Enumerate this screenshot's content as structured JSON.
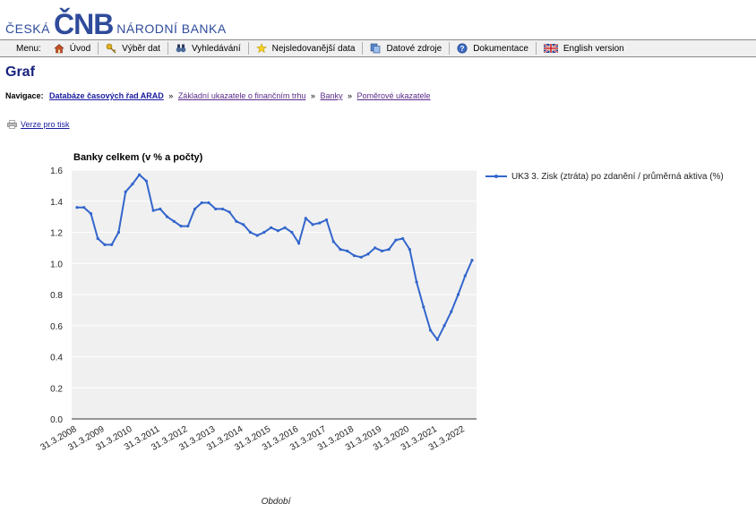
{
  "header": {
    "logo_left": "ČESKÁ",
    "logo_mid": "ČNB",
    "logo_right": "NÁRODNÍ BANKA"
  },
  "menu": {
    "label": "Menu:",
    "items": [
      {
        "label": "Úvod",
        "icon": "home-icon"
      },
      {
        "label": "Výběr dat",
        "icon": "key-icon"
      },
      {
        "label": "Vyhledávání",
        "icon": "binoculars-icon"
      },
      {
        "label": "Nejsledovanější data",
        "icon": "star-icon"
      },
      {
        "label": "Datové zdroje",
        "icon": "database-icon"
      },
      {
        "label": "Dokumentace",
        "icon": "help-icon"
      },
      {
        "label": "English version",
        "icon": "uk-flag-icon"
      }
    ]
  },
  "page": {
    "title": "Graf",
    "nav_label": "Navigace:",
    "breadcrumb": [
      "Databáze časových řad ARAD",
      "Základní ukazatele o finančním trhu",
      "Banky",
      "Poměrové ukazatele"
    ],
    "breadcrumb_sep": "»",
    "print_link": "Verze pro tisk"
  },
  "chart_data": {
    "type": "line",
    "title": "Banky celkem (v % a počty)",
    "xlabel": "Období",
    "ylabel": "",
    "ylim": [
      0,
      1.6
    ],
    "yticks": [
      "0.0",
      "0.2",
      "0.4",
      "0.6",
      "0.8",
      "1.0",
      "1.2",
      "1.4",
      "1.6"
    ],
    "xticks": [
      "31.3.2008",
      "31.3.2009",
      "31.3.2010",
      "31.3.2011",
      "31.3.2012",
      "31.3.2013",
      "31.3.2014",
      "31.3.2015",
      "31.3.2016",
      "31.3.2017",
      "31.3.2018",
      "31.3.2019",
      "31.3.2020",
      "31.3.2021",
      "31.3.2022"
    ],
    "grid": true,
    "legend_position": "right",
    "series_color": "#3366cc",
    "series": [
      {
        "name": "UK3 3. Zisk (ztráta) po zdanění / průměrná aktiva (%)",
        "values": [
          1.36,
          1.36,
          1.32,
          1.16,
          1.12,
          1.12,
          1.2,
          1.46,
          1.51,
          1.57,
          1.53,
          1.34,
          1.35,
          1.3,
          1.27,
          1.24,
          1.24,
          1.35,
          1.39,
          1.39,
          1.35,
          1.35,
          1.33,
          1.27,
          1.25,
          1.2,
          1.18,
          1.2,
          1.23,
          1.21,
          1.23,
          1.2,
          1.13,
          1.29,
          1.25,
          1.26,
          1.28,
          1.14,
          1.09,
          1.08,
          1.05,
          1.04,
          1.06,
          1.1,
          1.08,
          1.09,
          1.15,
          1.16,
          1.09,
          0.88,
          0.72,
          0.57,
          0.51,
          0.6,
          0.69,
          0.8,
          0.92,
          1.02
        ]
      }
    ]
  }
}
